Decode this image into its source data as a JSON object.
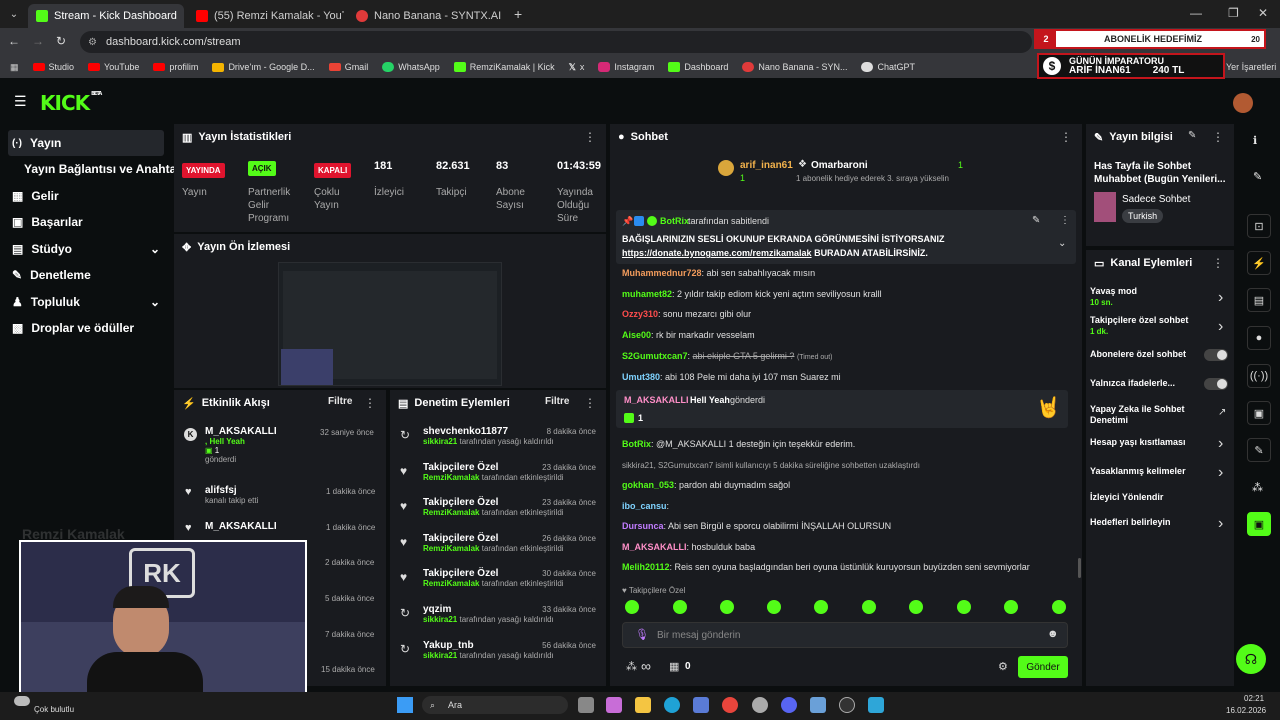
{
  "browser": {
    "tabs": [
      {
        "label": "Stream - Kick Dashboard",
        "color": "#53fc18",
        "active": true
      },
      {
        "label": "(55) Remzi Kamalak - YouTube",
        "color": "#ff0000"
      },
      {
        "label": "Nano Banana - SYNTX.AI",
        "color": "#e03a3a"
      }
    ],
    "url": "dashboard.kick.com/stream",
    "bookmarks": [
      "Studio",
      "YouTube",
      "profilim",
      "Drive'ım - Google D...",
      "Gmail",
      "WhatsApp",
      "RemziKamalak | Kick",
      "x",
      "Instagram",
      "Dashboard",
      "Nano Banana - SYN...",
      "ChatGPT"
    ],
    "bookmarks_right": "Yer İşaretleri",
    "tab_count": "20"
  },
  "overlay": {
    "goal_num": "2",
    "goal_label": "ABONELİK HEDEFİMİZ",
    "emperor_title": "GÜNÜN İMPARATORU",
    "emperor_name": "ARİF İNAN61",
    "emperor_amount": "240 TL"
  },
  "header": {
    "logo": "KICK",
    "beta": "BETA"
  },
  "sidebar": {
    "items": [
      {
        "label": "Yayın",
        "icon": "(·)"
      },
      {
        "label": "Yayın Bağlantısı ve Anahtarı",
        "icon": ""
      },
      {
        "label": "Gelir",
        "icon": "▦"
      },
      {
        "label": "Başarılar",
        "icon": "▣"
      },
      {
        "label": "Stüdyo",
        "icon": "▤"
      },
      {
        "label": "Denetleme",
        "icon": "✎"
      },
      {
        "label": "Topluluk",
        "icon": "♟"
      },
      {
        "label": "Droplar ve ödüller",
        "icon": "▩"
      }
    ]
  },
  "stats": {
    "title": "Yayın İstatistikleri",
    "badges": [
      {
        "text": "YAYINDA",
        "label": "Yayın"
      },
      {
        "text": "AÇIK",
        "label": "Partnerlik Gelir Programı"
      },
      {
        "text": "KAPALI",
        "label": "Çoklu Yayın"
      }
    ],
    "numbers": [
      {
        "value": "181",
        "label": "İzleyici"
      },
      {
        "value": "82.631",
        "label": "Takipçi"
      },
      {
        "value": "83",
        "label": "Abone Sayısı"
      },
      {
        "value": "01:43:59",
        "label": "Yayında Olduğu Süre"
      }
    ]
  },
  "preview": {
    "title": "Yayın Ön İzlemesi"
  },
  "activity": {
    "title": "Etkinlik Akışı",
    "filter": "Filtre",
    "items": [
      {
        "name": "M_AKSAKALLI",
        "msg": "Hell Yeah",
        "count": "1",
        "sub": "gönderdi",
        "time": "32 saniye önce"
      },
      {
        "name": "alifsfsj",
        "sub": "kanalı takip etti",
        "time": "1 dakika önce"
      },
      {
        "name": "M_AKSAKALLI",
        "time": "1 dakika önce"
      },
      {
        "time": "2 dakika önce"
      },
      {
        "time": "5 dakika önce"
      },
      {
        "time": "7 dakika önce"
      },
      {
        "time": "15 dakika önce"
      }
    ]
  },
  "moderation": {
    "title": "Denetim Eylemleri",
    "filter": "Filtre",
    "items": [
      {
        "t": "shevchenko11877",
        "by": "sikkira21",
        "s": "tarafından yasağı kaldırıldı",
        "time": "8 dakika önce",
        "icon": "↻"
      },
      {
        "t": "Takipçilere Özel",
        "by": "RemziKamalak",
        "s": "tarafından etkinleştirildi",
        "time": "23 dakika önce",
        "icon": "♥"
      },
      {
        "t": "Takipçilere Özel",
        "by": "RemziKamalak",
        "s": "tarafından etkinleştirildi",
        "time": "23 dakika önce",
        "icon": "♥"
      },
      {
        "t": "Takipçilere Özel",
        "by": "RemziKamalak",
        "s": "tarafından etkinleştirildi",
        "time": "26 dakika önce",
        "icon": "♥"
      },
      {
        "t": "Takipçilere Özel",
        "by": "RemziKamalak",
        "s": "tarafından etkinleştirildi",
        "time": "30 dakika önce",
        "icon": "♥"
      },
      {
        "t": "yqzim",
        "by": "sikkira21",
        "s": "tarafından yasağı kaldırıldı",
        "time": "33 dakika önce",
        "icon": "↻"
      },
      {
        "t": "Yakup_tnb",
        "by": "sikkira21",
        "s": "tarafından yasağı kaldırıldı",
        "time": "56 dakika önce",
        "icon": "↻"
      }
    ]
  },
  "webcam": {
    "watermark": "Remzi Kamalak",
    "logo": "RK"
  },
  "chat": {
    "title": "Sohbet",
    "top_user1": "arif_inan61",
    "top_user1_count": "1",
    "top_user2": "Omarbaroni",
    "top_user2_count": "1",
    "top_msg": "1 abonelik hediye ederek 3. sıraya yükselin",
    "pinned_by": "BotRix",
    "pinned_label": "tarafından sabitlendi",
    "pinned_text": "BAĞIŞLARINIZIN SESLİ OKUNUP EKRANDA GÖRÜNMESİNİ İSTİYORSANIZ",
    "pinned_link": "https://donate.bynogame.com/remzikamalak",
    "pinned_suffix": " BURADAN ATABİLİRSİNİZ.",
    "messages": [
      {
        "u": "Muhammednur728",
        "c": "#f39c5c",
        "m": "abi sen sabahlıyacak mısın"
      },
      {
        "u": "muhamet82",
        "c": "#53fc18",
        "m": "2 yıldır takip ediom kick yeni açtım seviliyosun kralll"
      },
      {
        "u": "Ozzy310",
        "c": "#ff4d4d",
        "m": "sonu mezarcı gibi olur"
      },
      {
        "u": "Aise00",
        "c": "#53fc18",
        "m": "rk bir markadır vesselam"
      },
      {
        "u": "S2Gumutxcan7",
        "c": "#53fc18",
        "m": "abi ekiple GTA 5 gelirmi ?",
        "note": "(Timed out)"
      },
      {
        "u": "Umut380",
        "c": "#7fd3ff",
        "m": "abi 108 Pele mi daha iyi 107 msn Suarez mi"
      }
    ],
    "gift": {
      "u": "M_AKSAKALLI",
      "m": "Hell Yeah",
      "s": "gönderdi",
      "count": "1"
    },
    "messages2": [
      {
        "u": "BotRix",
        "c": "#53fc18",
        "m": "@M_AKSAKALLI 1 desteğin için teşekkür ederim."
      },
      {
        "u": "",
        "c": "#aaa",
        "m": "sikkira21, S2Gumutxcan7 isimli kullanıcıyı 5 dakika süreliğine sohbetten uzaklaştırdı"
      },
      {
        "u": "gokhan_053",
        "c": "#53fc18",
        "m": "pardon abi duymadım sağol"
      },
      {
        "u": "ibo_cansu",
        "c": "#7fd3ff",
        "m": ""
      },
      {
        "u": "Dursunca",
        "c": "#c17cff",
        "m": "Abi sen Birgül e sporcu olabilirmi İNŞALLAH OLURSUN"
      },
      {
        "u": "M_AKSAKALLI",
        "c": "#ff8fc8",
        "m": "hosbulduk baba"
      },
      {
        "u": "Melih20112",
        "c": "#53fc18",
        "m": "Reis sen oyuna başladgından beri oyuna üstünlük kuruyorsun buyüzden seni sevmiyorlar"
      }
    ],
    "followers_only": "Takipçilere Özel",
    "placeholder": "Bir mesaj gönderin",
    "points": "∞",
    "gifts": "0",
    "send": "Gönder"
  },
  "stream_info": {
    "title": "Yayın bilgisi",
    "stream_title": "Has Tayfa ile Sohbet Muhabbet (Bugün Yenileri...",
    "category": "Sadece Sohbet",
    "language": "Turkish"
  },
  "channel_actions": {
    "title": "Kanal Eylemleri",
    "items": [
      {
        "label": "Yavaş mod",
        "sub": "10 sn.",
        "kind": "chev"
      },
      {
        "label": "Takipçilere özel sohbet",
        "sub": "1 dk.",
        "kind": "chev"
      },
      {
        "label": "Abonelere özel sohbet",
        "kind": "toggle"
      },
      {
        "label": "Yalnızca ifadelerle...",
        "kind": "toggle"
      },
      {
        "label": "Yapay Zeka ile Sohbet Denetimi",
        "kind": "ext"
      },
      {
        "label": "Hesap yaşı kısıtlaması",
        "kind": "chev"
      },
      {
        "label": "Yasaklanmış kelimeler",
        "kind": "chev"
      },
      {
        "label": "İzleyici Yönlendir",
        "kind": "none"
      },
      {
        "label": "Hedefleri belirleyin",
        "kind": "chev"
      }
    ]
  },
  "taskbar": {
    "weather": "Çok bulutlu",
    "search": "Ara",
    "time": "02:21",
    "date": "16.02.2026"
  },
  "colors": {
    "accent": "#53fc18",
    "live": "#e0142e",
    "bg": "#0b0e0f",
    "panel": "#191b1f"
  }
}
